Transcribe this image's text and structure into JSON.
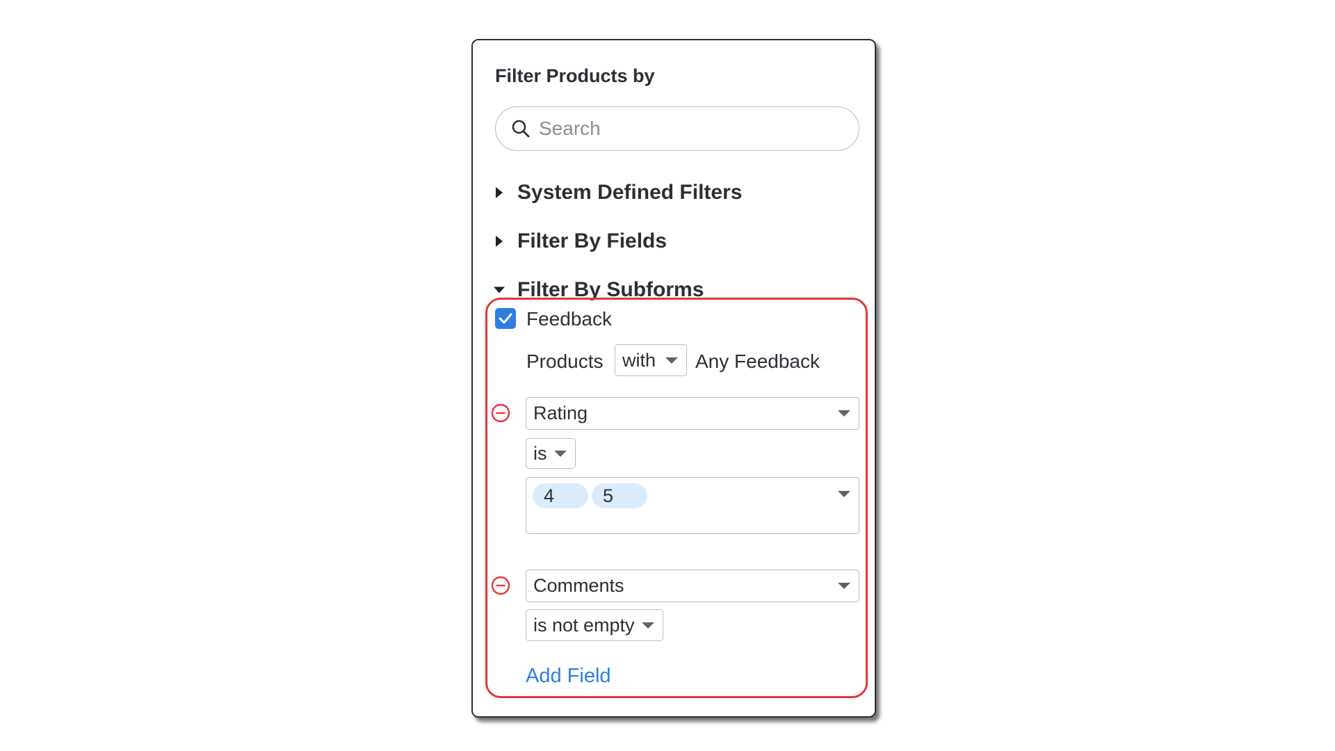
{
  "panel": {
    "title": "Filter Products by",
    "search": {
      "placeholder": "Search",
      "value": ""
    },
    "sections": [
      {
        "label": "System Defined Filters",
        "expanded": false
      },
      {
        "label": "Filter By Fields",
        "expanded": false
      },
      {
        "label": "Filter By Subforms",
        "expanded": true
      }
    ]
  },
  "subform": {
    "checkbox_label": "Feedback",
    "checked": true,
    "condition": {
      "prefix": "Products",
      "operator": "with",
      "suffix": "Any Feedback"
    },
    "criteria": [
      {
        "field": "Rating",
        "operator": "is",
        "values": [
          "4",
          "5"
        ]
      },
      {
        "field": "Comments",
        "operator": "is not empty"
      }
    ],
    "add_field_label": "Add Field"
  },
  "colors": {
    "accent": "#2f7de1",
    "highlight": "#e5343a",
    "remove": "#e5343a",
    "chip": "#dcebfb"
  },
  "icons": {
    "search": "search-icon",
    "collapsed": "caret-right-icon",
    "expanded": "caret-down-icon",
    "remove": "minus-circle-icon",
    "check": "checkmark-icon",
    "dropdown": "chevron-down-icon"
  }
}
